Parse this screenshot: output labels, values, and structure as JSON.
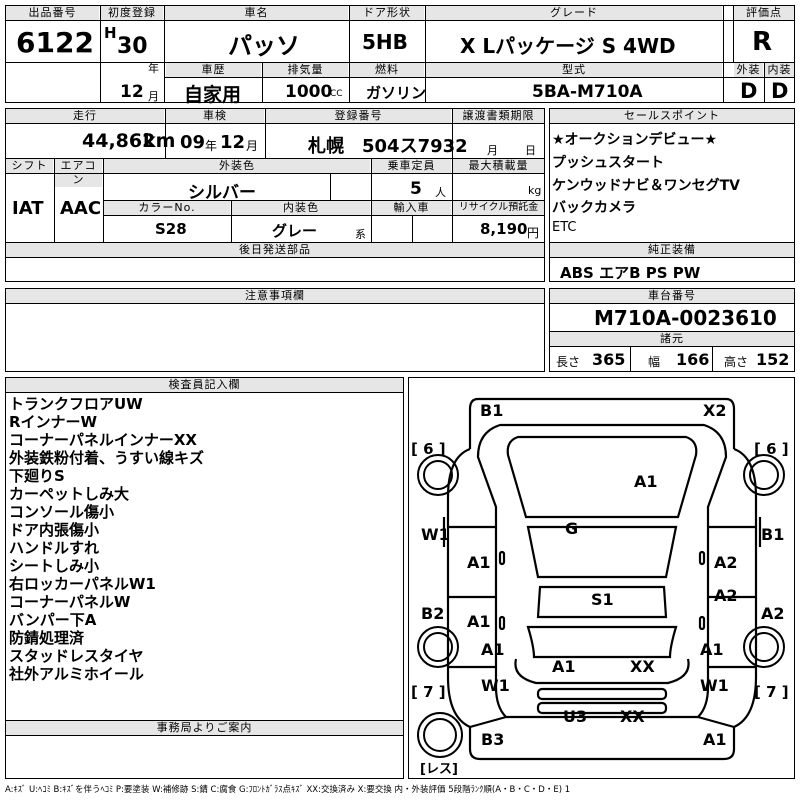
{
  "header": {
    "lot_label": "出品番号",
    "lot_no": "6122",
    "first_reg_label": "初度登録",
    "era": "H",
    "reg_year": "30",
    "year_unit": "年",
    "reg_month": "12",
    "month_unit": "月",
    "name_label": "車名",
    "car_name": "パッソ",
    "door_label": "ドア形状",
    "door": "5HB",
    "grade_label": "グレード",
    "grade": "X Lパッケージ S 4WD",
    "score_label": "評価点",
    "score": "R",
    "history_label": "車歴",
    "history": "自家用",
    "disp_label": "排気量",
    "displacement": "1000",
    "cc": "CC",
    "fuel_label": "燃料",
    "fuel": "ガソリン",
    "model_label": "型式",
    "model": "5BA-M710A",
    "ext_label": "外装",
    "ext": "D",
    "int_label": "内装",
    "int": "D"
  },
  "info": {
    "mileage_label": "走行",
    "mileage": "44,862",
    "km": "km",
    "inspection_label": "車検",
    "insp_year": "09",
    "insp_year_unit": "年",
    "insp_month": "12",
    "insp_month_unit": "月",
    "plate_label": "登録番号",
    "plate_city": "札幌",
    "plate_no": "504ス7932",
    "transfer_label": "譲渡書類期限",
    "transfer_month_unit": "月",
    "transfer_day_unit": "日",
    "shift_label": "シフト",
    "shift": "IAT",
    "ac_label": "エアコン",
    "ac": "AAC",
    "color_label": "外装色",
    "color": "シルバー",
    "capacity_label": "乗車定員",
    "capacity": "5",
    "person_unit": "人",
    "load_label": "最大積載量",
    "kg": "kg",
    "color_no_label": "カラーNo.",
    "color_no": "S28",
    "interior_color_label": "内装色",
    "interior_color": "グレー",
    "kei": "系",
    "import_label": "輸入車",
    "recycle_label": "リサイクル預託金",
    "recycle": "8,190",
    "yen": "円",
    "later_label": "後日発送部品"
  },
  "selling_points": {
    "label": "セールスポイント",
    "items": [
      "★オークションデビュー★",
      "プッシュスタート",
      "ケンウッドナビ＆ワンセグTV",
      "バックカメラ",
      "ETC"
    ]
  },
  "equipment": {
    "label": "純正装備",
    "value": "ABS エアB PS PW"
  },
  "caution": {
    "label": "注意事項欄"
  },
  "chassis": {
    "label": "車台番号",
    "value": "M710A-0023610",
    "dims_label": "諸元",
    "length_label": "長さ",
    "length": "365",
    "width_label": "幅",
    "width": "166",
    "height_label": "高さ",
    "height": "152"
  },
  "inspector": {
    "label": "検査員記入欄",
    "notes": [
      "トランクフロアUW",
      "RインナーW",
      "コーナーパネルインナーXX",
      "外装鉄粉付着、うすい線キズ",
      "下廻りS",
      "カーペットしみ大",
      "コンソール傷小",
      "ドア内張傷小",
      "ハンドルすれ",
      "シートしみ小",
      "右ロッカーパネルW1",
      "コーナーパネルW",
      "バンパー下A",
      "防錆処理済",
      "スタッドレスタイヤ",
      "社外アルミホイール"
    ]
  },
  "office": {
    "label": "事務局よりご案内"
  },
  "diagram": {
    "marks": {
      "m1": "B1",
      "m2": "X2",
      "m3": "A1",
      "m4": "W1",
      "m5": "B1",
      "m6": "G",
      "m7": "A1",
      "m8": "A2",
      "m9": "S1",
      "m10": "B2",
      "m11": "A1",
      "m12": "A2",
      "m13": "A2",
      "m14": "A1",
      "m15": "A1",
      "m16": "A1",
      "m17": "XX",
      "m18": "W1",
      "m19": "W1",
      "m20": "U3",
      "m21": "XX",
      "m22": "B3",
      "m23": "A1"
    },
    "tire_tl": "[ 6 ]",
    "tire_tr": "[ 6 ]",
    "tire_bl": "[ 7 ]",
    "tire_br": "[ 7 ]",
    "spare": "[レス]"
  },
  "legend": "A:ｷｽﾞ U:ﾍｺﾐ B:ｷｽﾞを伴うﾍｺﾐ P:要塗装 W:補修跡 S:錆 C:腐食 G:ﾌﾛﾝﾄｶﾞﾗｽ点ｷｽﾞ XX:交換済み X:要交換 内・外装評価 5段階ﾗﾝｸ順(A・B・C・D・E) 1"
}
